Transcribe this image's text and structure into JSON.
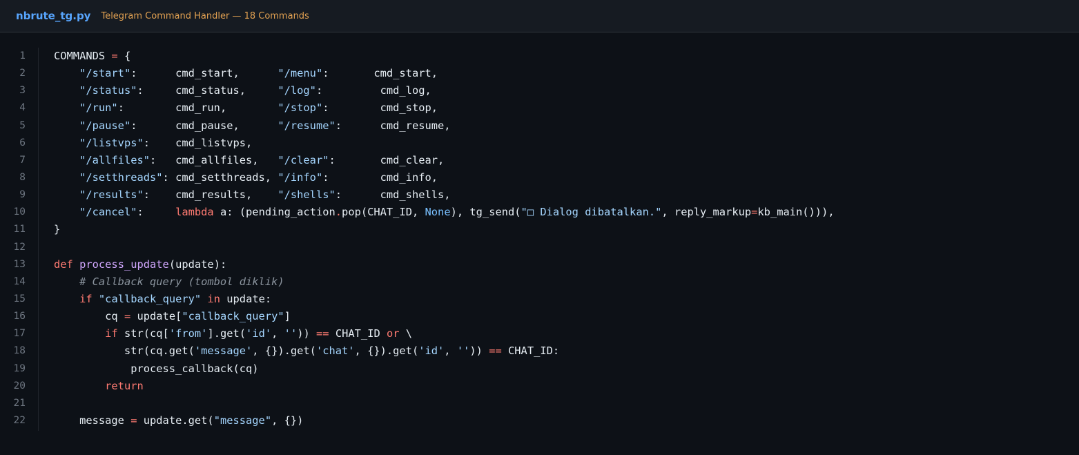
{
  "header": {
    "filename": "nbrute_tg.py",
    "subtitle": "Telegram Command Handler — 18 Commands"
  },
  "colors": {
    "background": "#0d1117",
    "header_background": "#161b22",
    "filename": "#58a6ff",
    "subtitle": "#e3a252",
    "string": "#a5d6ff",
    "keyword": "#ff7b72",
    "function": "#d2a8ff",
    "comment": "#8b949e",
    "text": "#e6edf3"
  },
  "code": {
    "lines": [
      {
        "n": "1",
        "tokens": [
          [
            "t",
            "COMMANDS "
          ],
          [
            "op",
            "="
          ],
          [
            "t",
            " {"
          ]
        ]
      },
      {
        "n": "2",
        "tokens": [
          [
            "t",
            "    "
          ],
          [
            "s",
            "\"/start\""
          ],
          [
            "t",
            ":      cmd_start,      "
          ],
          [
            "s",
            "\"/menu\""
          ],
          [
            "t",
            ":       cmd_start,"
          ]
        ]
      },
      {
        "n": "3",
        "tokens": [
          [
            "t",
            "    "
          ],
          [
            "s",
            "\"/status\""
          ],
          [
            "t",
            ":     cmd_status,     "
          ],
          [
            "s",
            "\"/log\""
          ],
          [
            "t",
            ":         cmd_log,"
          ]
        ]
      },
      {
        "n": "4",
        "tokens": [
          [
            "t",
            "    "
          ],
          [
            "s",
            "\"/run\""
          ],
          [
            "t",
            ":        cmd_run,        "
          ],
          [
            "s",
            "\"/stop\""
          ],
          [
            "t",
            ":        cmd_stop,"
          ]
        ]
      },
      {
        "n": "5",
        "tokens": [
          [
            "t",
            "    "
          ],
          [
            "s",
            "\"/pause\""
          ],
          [
            "t",
            ":      cmd_pause,      "
          ],
          [
            "s",
            "\"/resume\""
          ],
          [
            "t",
            ":      cmd_resume,"
          ]
        ]
      },
      {
        "n": "6",
        "tokens": [
          [
            "t",
            "    "
          ],
          [
            "s",
            "\"/listvps\""
          ],
          [
            "t",
            ":    cmd_listvps,"
          ]
        ]
      },
      {
        "n": "7",
        "tokens": [
          [
            "t",
            "    "
          ],
          [
            "s",
            "\"/allfiles\""
          ],
          [
            "t",
            ":   cmd_allfiles,   "
          ],
          [
            "s",
            "\"/clear\""
          ],
          [
            "t",
            ":       cmd_clear,"
          ]
        ]
      },
      {
        "n": "8",
        "tokens": [
          [
            "t",
            "    "
          ],
          [
            "s",
            "\"/setthreads\""
          ],
          [
            "t",
            ": cmd_setthreads, "
          ],
          [
            "s",
            "\"/info\""
          ],
          [
            "t",
            ":        cmd_info,"
          ]
        ]
      },
      {
        "n": "9",
        "tokens": [
          [
            "t",
            "    "
          ],
          [
            "s",
            "\"/results\""
          ],
          [
            "t",
            ":    cmd_results,    "
          ],
          [
            "s",
            "\"/shells\""
          ],
          [
            "t",
            ":      cmd_shells,"
          ]
        ]
      },
      {
        "n": "10",
        "tokens": [
          [
            "t",
            "    "
          ],
          [
            "s",
            "\"/cancel\""
          ],
          [
            "t",
            ":     "
          ],
          [
            "kw",
            "lambda"
          ],
          [
            "t",
            " a: (pending_action"
          ],
          [
            "op",
            "."
          ],
          [
            "t",
            "pop(CHAT_ID, "
          ],
          [
            "cst",
            "None"
          ],
          [
            "t",
            "), tg_send("
          ],
          [
            "s",
            "\"□ Dialog dibatalkan.\""
          ],
          [
            "t",
            ", reply_markup"
          ],
          [
            "op",
            "="
          ],
          [
            "t",
            "kb_main())),"
          ]
        ]
      },
      {
        "n": "11",
        "tokens": [
          [
            "t",
            "}"
          ]
        ]
      },
      {
        "n": "12",
        "tokens": []
      },
      {
        "n": "13",
        "tokens": [
          [
            "kw",
            "def"
          ],
          [
            "t",
            " "
          ],
          [
            "fn",
            "process_update"
          ],
          [
            "t",
            "(update):"
          ]
        ]
      },
      {
        "n": "14",
        "tokens": [
          [
            "t",
            "    "
          ],
          [
            "cm",
            "# Callback query (tombol diklik)"
          ]
        ]
      },
      {
        "n": "15",
        "tokens": [
          [
            "t",
            "    "
          ],
          [
            "kw",
            "if"
          ],
          [
            "t",
            " "
          ],
          [
            "s",
            "\"callback_query\""
          ],
          [
            "t",
            " "
          ],
          [
            "kw",
            "in"
          ],
          [
            "t",
            " update:"
          ]
        ]
      },
      {
        "n": "16",
        "tokens": [
          [
            "t",
            "        cq "
          ],
          [
            "op",
            "="
          ],
          [
            "t",
            " update["
          ],
          [
            "s",
            "\"callback_query\""
          ],
          [
            "t",
            "]"
          ]
        ]
      },
      {
        "n": "17",
        "tokens": [
          [
            "t",
            "        "
          ],
          [
            "kw",
            "if"
          ],
          [
            "t",
            " str(cq["
          ],
          [
            "s",
            "'from'"
          ],
          [
            "t",
            "].get("
          ],
          [
            "s",
            "'id'"
          ],
          [
            "t",
            ", "
          ],
          [
            "s",
            "''"
          ],
          [
            "t",
            ")) "
          ],
          [
            "op",
            "=="
          ],
          [
            "t",
            " CHAT_ID "
          ],
          [
            "kw",
            "or"
          ],
          [
            "t",
            " \\"
          ]
        ]
      },
      {
        "n": "18",
        "tokens": [
          [
            "t",
            "           str(cq.get("
          ],
          [
            "s",
            "'message'"
          ],
          [
            "t",
            ", {}).get("
          ],
          [
            "s",
            "'chat'"
          ],
          [
            "t",
            ", {}).get("
          ],
          [
            "s",
            "'id'"
          ],
          [
            "t",
            ", "
          ],
          [
            "s",
            "''"
          ],
          [
            "t",
            ")) "
          ],
          [
            "op",
            "=="
          ],
          [
            "t",
            " CHAT_ID:"
          ]
        ]
      },
      {
        "n": "19",
        "tokens": [
          [
            "t",
            "            process_callback(cq)"
          ]
        ]
      },
      {
        "n": "20",
        "tokens": [
          [
            "t",
            "        "
          ],
          [
            "kw",
            "return"
          ]
        ]
      },
      {
        "n": "21",
        "tokens": []
      },
      {
        "n": "22",
        "tokens": [
          [
            "t",
            "    message "
          ],
          [
            "op",
            "="
          ],
          [
            "t",
            " update.get("
          ],
          [
            "s",
            "\"message\""
          ],
          [
            "t",
            ", {})"
          ]
        ]
      }
    ]
  }
}
